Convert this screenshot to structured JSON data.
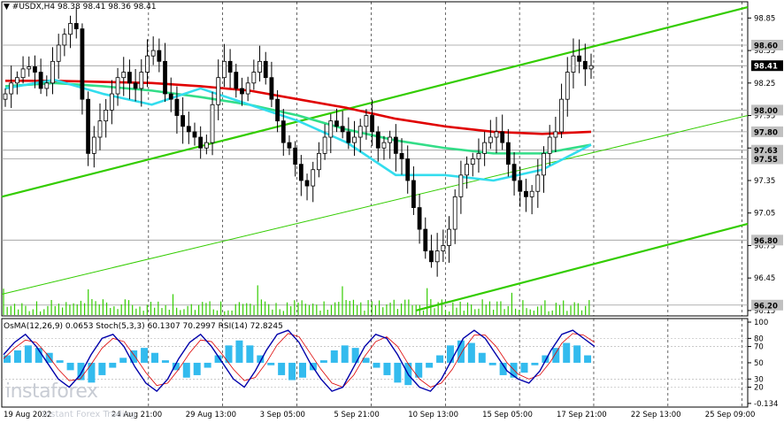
{
  "header": {
    "symbol": "#USDX,H4",
    "ohlc": "98.38 98.41 98.36 98.41",
    "indicator": "OsMA(12,26,9) 0.0653  Stoch(5,3,3) 60.1307 70.2997  RSI(14) 72.8245"
  },
  "watermark": {
    "brand": "instaforex",
    "tagline": "Instant Forex Trading"
  },
  "colors": {
    "price": "#000000",
    "ma_red": "#e00000",
    "ma_green": "#33dd88",
    "ma_cyan": "#33ddee",
    "channel": "#33cc00",
    "osma": "#33bbee",
    "stoch_main": "#0000aa",
    "stoch_signal": "#dd0000"
  },
  "chart_data": [
    {
      "type": "candlestick",
      "title": "#USDX,H4",
      "ylim": [
        96.1,
        99.0
      ],
      "y_ticks": [
        {
          "value": 98.85,
          "label": "98.85"
        },
        {
          "value": 98.55,
          "label": "98.55"
        },
        {
          "value": 98.25,
          "label": "98.25"
        },
        {
          "value": 97.95,
          "label": "97.95"
        },
        {
          "value": 97.65,
          "label": "97.65"
        },
        {
          "value": 97.35,
          "label": "97.35"
        },
        {
          "value": 97.05,
          "label": "97.05"
        },
        {
          "value": 96.75,
          "label": "96.75"
        },
        {
          "value": 96.45,
          "label": "96.45"
        },
        {
          "value": 96.15,
          "label": "96.15"
        }
      ],
      "levels": [
        {
          "value": 98.6,
          "label": "98.60",
          "style": "gray"
        },
        {
          "value": 98.41,
          "label": "98.41",
          "style": "current"
        },
        {
          "value": 98.0,
          "label": "98.00",
          "style": "gray"
        },
        {
          "value": 97.8,
          "label": "97.80",
          "style": "gray"
        },
        {
          "value": 97.63,
          "label": "97.63",
          "style": "gray"
        },
        {
          "value": 97.55,
          "label": "97.55",
          "style": "gray"
        },
        {
          "value": 96.8,
          "label": "96.80",
          "style": "gray"
        },
        {
          "value": 96.2,
          "label": "96.20",
          "style": "gray"
        }
      ],
      "x_labels": [
        "19 Aug 2022",
        "24 Aug 21:00",
        "29 Aug 13:00",
        "3 Sep 05:00",
        "5 Sep 21:00",
        "10 Sep 13:00",
        "15 Sep 05:00",
        "17 Sep 21:00",
        "22 Sep 13:00",
        "25 Sep 09:00"
      ],
      "close_series": [
        98.15,
        98.25,
        98.3,
        98.38,
        98.4,
        98.35,
        98.2,
        98.25,
        98.45,
        98.6,
        98.7,
        98.8,
        98.75,
        98.1,
        97.6,
        97.75,
        97.9,
        98.0,
        98.15,
        98.3,
        98.35,
        98.25,
        98.2,
        98.35,
        98.5,
        98.55,
        98.45,
        98.15,
        98.1,
        97.95,
        97.85,
        97.8,
        97.75,
        97.65,
        97.7,
        98.05,
        98.3,
        98.45,
        98.35,
        98.2,
        98.15,
        98.25,
        98.35,
        98.45,
        98.3,
        98.1,
        97.9,
        97.7,
        97.65,
        97.5,
        97.35,
        97.3,
        97.45,
        97.6,
        97.75,
        97.9,
        97.85,
        97.8,
        97.7,
        97.75,
        97.85,
        97.95,
        97.8,
        97.65,
        97.7,
        97.75,
        97.6,
        97.55,
        97.35,
        97.1,
        96.9,
        96.7,
        96.6,
        96.7,
        96.75,
        96.9,
        97.2,
        97.4,
        97.5,
        97.55,
        97.6,
        97.7,
        97.75,
        97.8,
        97.7,
        97.5,
        97.35,
        97.25,
        97.2,
        97.25,
        97.4,
        97.6,
        97.75,
        97.8,
        98.1,
        98.35,
        98.5,
        98.45,
        98.38,
        98.41
      ],
      "moving_averages": [
        {
          "color": "ma_red",
          "values": [
            98.27,
            98.27,
            98.26,
            98.25,
            98.22,
            98.18,
            98.1,
            98.02,
            97.92,
            97.85,
            97.8,
            97.78,
            97.8
          ]
        },
        {
          "color": "ma_green",
          "values": [
            98.22,
            98.25,
            98.22,
            98.18,
            98.12,
            98.05,
            97.95,
            97.82,
            97.72,
            97.65,
            97.6,
            97.6,
            97.68
          ]
        },
        {
          "color": "ma_cyan",
          "values": [
            98.2,
            98.28,
            98.15,
            98.05,
            98.2,
            98.05,
            97.9,
            97.7,
            97.4,
            97.4,
            97.35,
            97.45,
            97.68
          ]
        }
      ],
      "channel_lines": [
        {
          "from": 97.2,
          "to": 98.95,
          "weight": "thick"
        },
        {
          "from": 96.3,
          "to": 97.95,
          "weight": "thin"
        },
        {
          "from": 96.15,
          "to": 96.95,
          "weight": "thick"
        }
      ],
      "current_price": 98.41
    },
    {
      "type": "bar",
      "title": "OsMA(12,26,9) 0.0653  Stoch(5,3,3) 60.1307 70.2997  RSI(14) 72.8245",
      "ylim": [
        -0.134,
        100
      ],
      "y_ticks": [
        {
          "value": 100,
          "label": "100"
        },
        {
          "value": 80,
          "label": "80"
        },
        {
          "value": 70,
          "label": "70"
        },
        {
          "value": 50,
          "label": "50"
        },
        {
          "value": 30,
          "label": "30"
        },
        {
          "value": 20,
          "label": "20"
        },
        {
          "value": 0,
          "label": "-0.134"
        }
      ],
      "osma_values": [
        0.3,
        0.5,
        0.7,
        0.6,
        0.4,
        0.1,
        -0.3,
        -0.7,
        -0.8,
        -0.5,
        -0.2,
        0.2,
        0.5,
        0.6,
        0.4,
        0.1,
        -0.3,
        -0.6,
        -0.5,
        -0.2,
        0.3,
        0.7,
        0.9,
        0.7,
        0.3,
        -0.1,
        -0.5,
        -0.7,
        -0.6,
        -0.3,
        0.1,
        0.5,
        0.7,
        0.6,
        0.2,
        -0.2,
        -0.5,
        -0.8,
        -0.9,
        -0.6,
        -0.2,
        0.3,
        0.7,
        0.9,
        0.8,
        0.4,
        -0.1,
        -0.5,
        -0.6,
        -0.4,
        -0.1,
        0.3,
        0.6,
        0.8,
        0.7,
        0.3
      ],
      "stoch_main": [
        60,
        75,
        85,
        70,
        50,
        30,
        20,
        35,
        60,
        80,
        85,
        70,
        45,
        25,
        15,
        30,
        55,
        75,
        85,
        70,
        50,
        30,
        20,
        40,
        65,
        85,
        90,
        75,
        50,
        30,
        15,
        20,
        45,
        70,
        85,
        80,
        60,
        35,
        20,
        15,
        30,
        55,
        80,
        90,
        80,
        60,
        40,
        30,
        25,
        40,
        65,
        85,
        90,
        80,
        70
      ],
      "stoch_signal": [
        55,
        68,
        78,
        75,
        60,
        42,
        28,
        30,
        48,
        68,
        80,
        76,
        58,
        38,
        22,
        25,
        42,
        62,
        78,
        76,
        60,
        42,
        28,
        32,
        50,
        72,
        86,
        82,
        62,
        42,
        25,
        20,
        35,
        58,
        76,
        82,
        70,
        48,
        30,
        20,
        25,
        42,
        66,
        84,
        84,
        70,
        50,
        36,
        30,
        35,
        52,
        74,
        86,
        84,
        75
      ]
    }
  ]
}
